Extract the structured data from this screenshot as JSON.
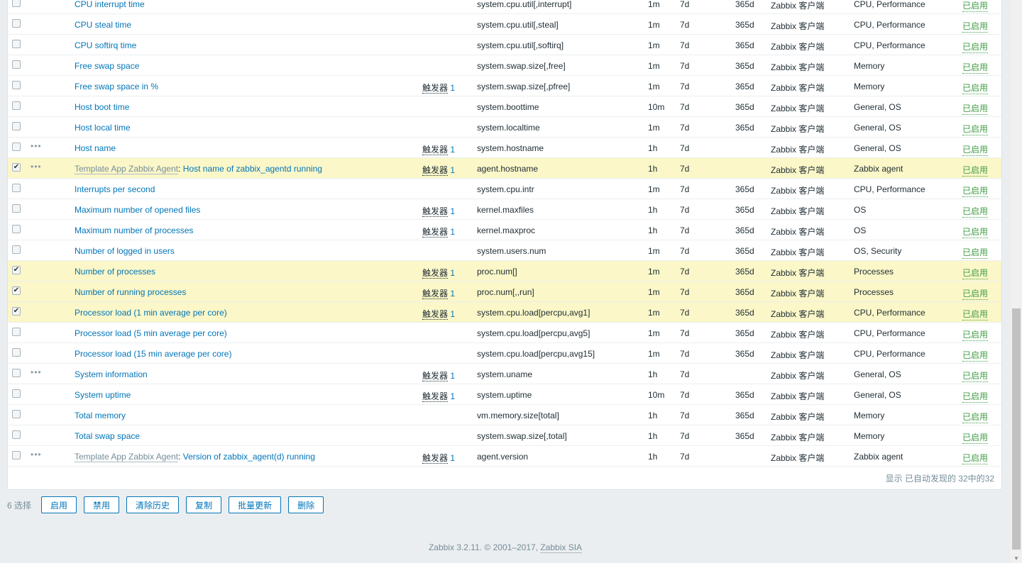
{
  "trigger_label": "触发器",
  "rows": [
    {
      "name": "CPU interrupt time",
      "trig": "",
      "key": "system.cpu.util[,interrupt]",
      "int": "1m",
      "hist": "7d",
      "trend": "365d",
      "type": "Zabbix 客户端",
      "app": "CPU, Performance",
      "status": "已启用"
    },
    {
      "name": "CPU steal time",
      "trig": "",
      "key": "system.cpu.util[,steal]",
      "int": "1m",
      "hist": "7d",
      "trend": "365d",
      "type": "Zabbix 客户端",
      "app": "CPU, Performance",
      "status": "已启用"
    },
    {
      "name": "CPU softirq time",
      "trig": "",
      "key": "system.cpu.util[,softirq]",
      "int": "1m",
      "hist": "7d",
      "trend": "365d",
      "type": "Zabbix 客户端",
      "app": "CPU, Performance",
      "status": "已启用"
    },
    {
      "name": "Free swap space",
      "trig": "",
      "key": "system.swap.size[,free]",
      "int": "1m",
      "hist": "7d",
      "trend": "365d",
      "type": "Zabbix 客户端",
      "app": "Memory",
      "status": "已启用"
    },
    {
      "name": "Free swap space in %",
      "trig": "1",
      "key": "system.swap.size[,pfree]",
      "int": "1m",
      "hist": "7d",
      "trend": "365d",
      "type": "Zabbix 客户端",
      "app": "Memory",
      "status": "已启用"
    },
    {
      "name": "Host boot time",
      "trig": "",
      "key": "system.boottime",
      "int": "10m",
      "hist": "7d",
      "trend": "365d",
      "type": "Zabbix 客户端",
      "app": "General, OS",
      "status": "已启用"
    },
    {
      "name": "Host local time",
      "trig": "",
      "key": "system.localtime",
      "int": "1m",
      "hist": "7d",
      "trend": "365d",
      "type": "Zabbix 客户端",
      "app": "General, OS",
      "status": "已启用"
    },
    {
      "name": "Host name",
      "dots": true,
      "trig": "1",
      "key": "system.hostname",
      "int": "1h",
      "hist": "7d",
      "trend": "",
      "type": "Zabbix 客户端",
      "app": "General, OS",
      "status": "已启用"
    },
    {
      "template": "Template App Zabbix Agent",
      "name": "Host name of zabbix_agentd running",
      "dots": true,
      "checked": true,
      "trig": "1",
      "key": "agent.hostname",
      "int": "1h",
      "hist": "7d",
      "trend": "",
      "type": "Zabbix 客户端",
      "app": "Zabbix agent",
      "status": "已启用"
    },
    {
      "name": "Interrupts per second",
      "trig": "",
      "key": "system.cpu.intr",
      "int": "1m",
      "hist": "7d",
      "trend": "365d",
      "type": "Zabbix 客户端",
      "app": "CPU, Performance",
      "status": "已启用"
    },
    {
      "name": "Maximum number of opened files",
      "trig": "1",
      "key": "kernel.maxfiles",
      "int": "1h",
      "hist": "7d",
      "trend": "365d",
      "type": "Zabbix 客户端",
      "app": "OS",
      "status": "已启用"
    },
    {
      "name": "Maximum number of processes",
      "trig": "1",
      "key": "kernel.maxproc",
      "int": "1h",
      "hist": "7d",
      "trend": "365d",
      "type": "Zabbix 客户端",
      "app": "OS",
      "status": "已启用"
    },
    {
      "name": "Number of logged in users",
      "trig": "",
      "key": "system.users.num",
      "int": "1m",
      "hist": "7d",
      "trend": "365d",
      "type": "Zabbix 客户端",
      "app": "OS, Security",
      "status": "已启用"
    },
    {
      "name": "Number of processes",
      "checked": true,
      "trig": "1",
      "key": "proc.num[]",
      "int": "1m",
      "hist": "7d",
      "trend": "365d",
      "type": "Zabbix 客户端",
      "app": "Processes",
      "status": "已启用"
    },
    {
      "name": "Number of running processes",
      "checked": true,
      "trig": "1",
      "key": "proc.num[,,run]",
      "int": "1m",
      "hist": "7d",
      "trend": "365d",
      "type": "Zabbix 客户端",
      "app": "Processes",
      "status": "已启用"
    },
    {
      "name": "Processor load (1 min average per core)",
      "checked": true,
      "trig": "1",
      "key": "system.cpu.load[percpu,avg1]",
      "int": "1m",
      "hist": "7d",
      "trend": "365d",
      "type": "Zabbix 客户端",
      "app": "CPU, Performance",
      "status": "已启用"
    },
    {
      "name": "Processor load (5 min average per core)",
      "trig": "",
      "key": "system.cpu.load[percpu,avg5]",
      "int": "1m",
      "hist": "7d",
      "trend": "365d",
      "type": "Zabbix 客户端",
      "app": "CPU, Performance",
      "status": "已启用"
    },
    {
      "name": "Processor load (15 min average per core)",
      "trig": "",
      "key": "system.cpu.load[percpu,avg15]",
      "int": "1m",
      "hist": "7d",
      "trend": "365d",
      "type": "Zabbix 客户端",
      "app": "CPU, Performance",
      "status": "已启用"
    },
    {
      "name": "System information",
      "dots": true,
      "trig": "1",
      "key": "system.uname",
      "int": "1h",
      "hist": "7d",
      "trend": "",
      "type": "Zabbix 客户端",
      "app": "General, OS",
      "status": "已启用"
    },
    {
      "name": "System uptime",
      "trig": "1",
      "key": "system.uptime",
      "int": "10m",
      "hist": "7d",
      "trend": "365d",
      "type": "Zabbix 客户端",
      "app": "General, OS",
      "status": "已启用"
    },
    {
      "name": "Total memory",
      "trig": "",
      "key": "vm.memory.size[total]",
      "int": "1h",
      "hist": "7d",
      "trend": "365d",
      "type": "Zabbix 客户端",
      "app": "Memory",
      "status": "已启用"
    },
    {
      "name": "Total swap space",
      "trig": "",
      "key": "system.swap.size[,total]",
      "int": "1h",
      "hist": "7d",
      "trend": "365d",
      "type": "Zabbix 客户端",
      "app": "Memory",
      "status": "已启用"
    },
    {
      "template": "Template App Zabbix Agent",
      "name": "Version of zabbix_agent(d) running",
      "dots": true,
      "trig": "1",
      "key": "agent.version",
      "int": "1h",
      "hist": "7d",
      "trend": "",
      "type": "Zabbix 客户端",
      "app": "Zabbix agent",
      "status": "已启用"
    }
  ],
  "footer": "显示 已自动发现的 32中的32",
  "actions": {
    "count": "6 选择",
    "enable": "启用",
    "disable": "禁用",
    "clear": "清除历史",
    "copy": "复制",
    "mass_update": "批量更新",
    "delete": "删除"
  },
  "copyright": {
    "text": "Zabbix 3.2.11. © 2001–2017, ",
    "link": "Zabbix SIA"
  }
}
